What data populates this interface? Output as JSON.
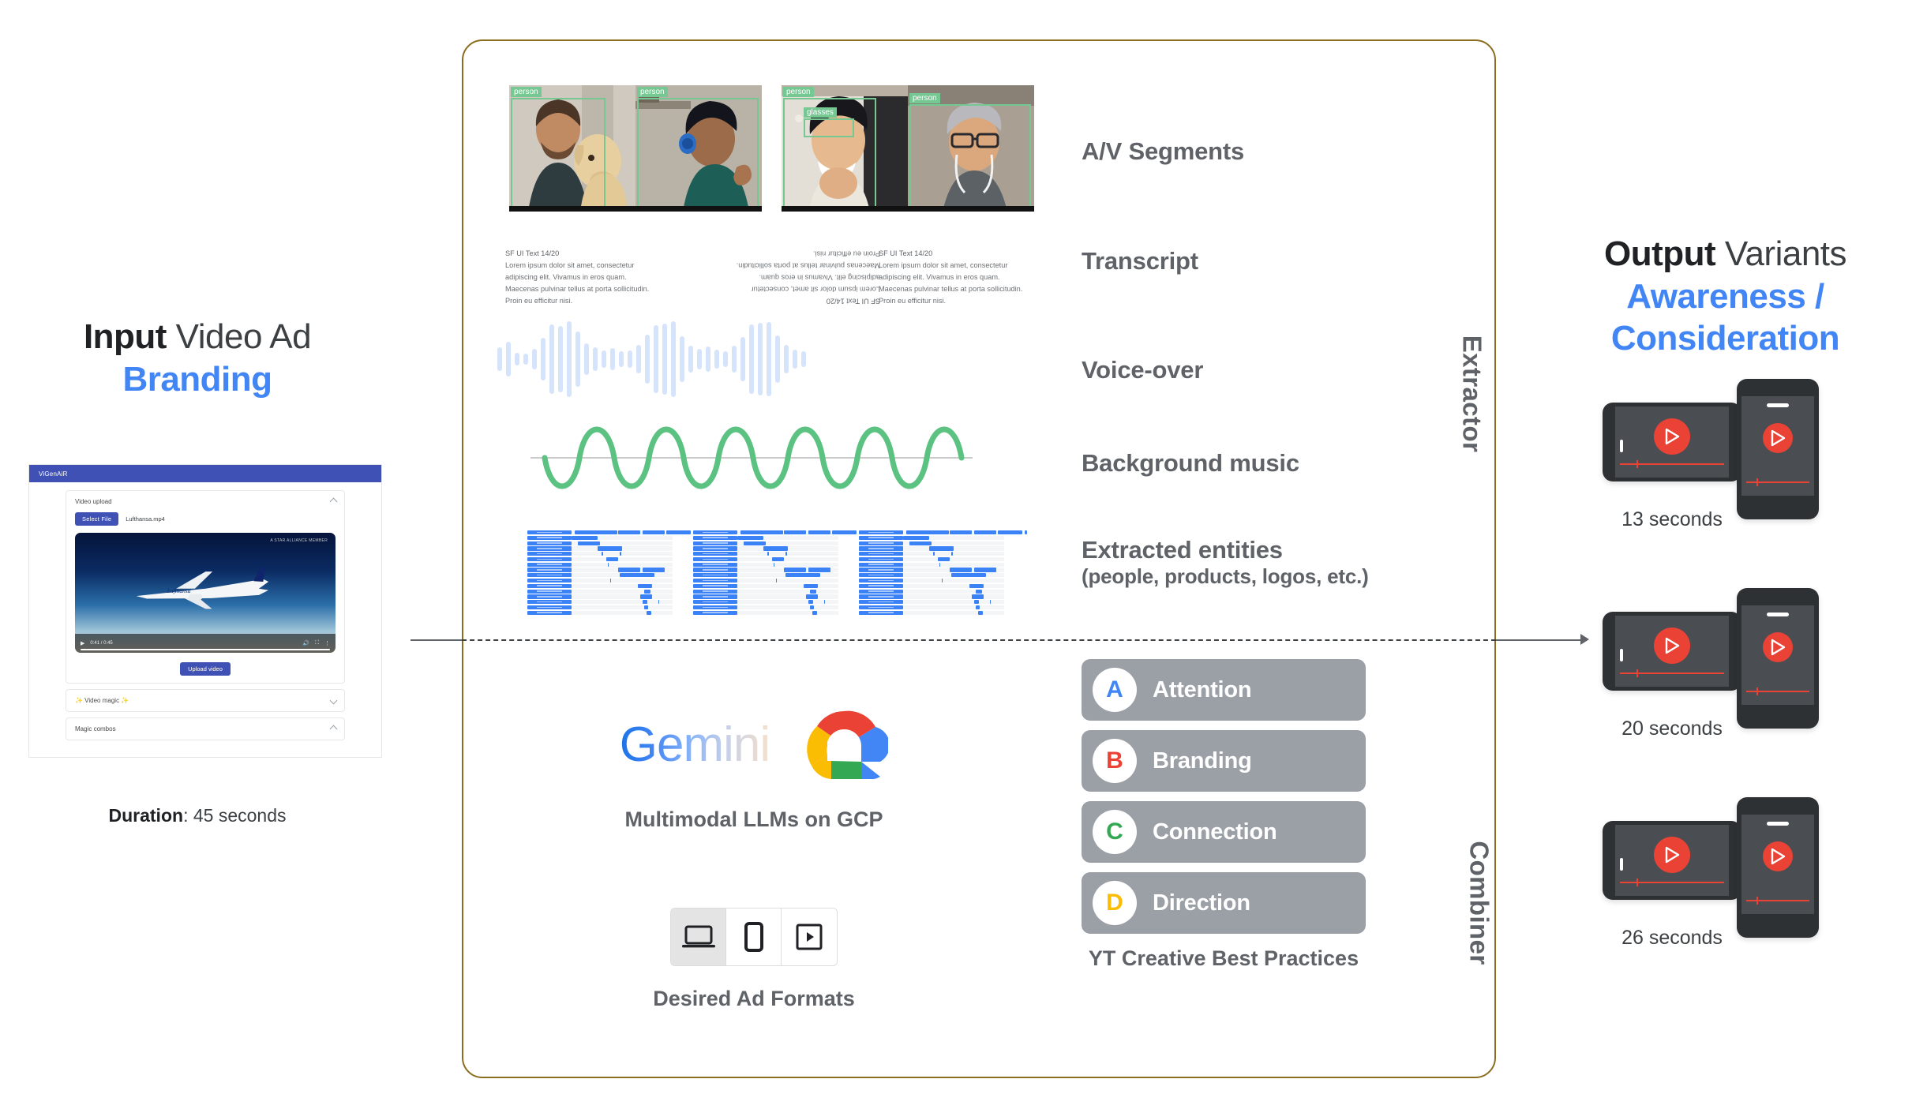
{
  "input": {
    "title_bold": "Input",
    "title_rest": " Video Ad",
    "title_accent": "Branding",
    "duration_label": "Duration",
    "duration_value": ": 45 seconds",
    "app": {
      "app_name": "ViGenAiR",
      "upload_card_title": "Video upload",
      "select_file_button": "Select File",
      "file_name": "Lufthansa.mp4",
      "star_alliance": "A STAR ALLIANCE MEMBER",
      "time_current": "0:41 / 0:45",
      "upload_button": "Upload video",
      "video_magic_title": "✨ Video magic ✨",
      "magic_combos_title": "Magic combos",
      "brand_text": "Lufthansa"
    }
  },
  "panel": {
    "section_extractor": "Extractor",
    "section_combiner": "Combiner",
    "border_color": "#8a6d1f",
    "rows": [
      {
        "label": "A/V Segments",
        "sub": ""
      },
      {
        "label": "Transcript",
        "sub": ""
      },
      {
        "label": "Voice-over",
        "sub": ""
      },
      {
        "label": "Background music",
        "sub": ""
      },
      {
        "label": "Extracted entities",
        "sub": "(people, products, logos, etc.)"
      }
    ],
    "detections": [
      {
        "tag": "person"
      },
      {
        "tag": "person"
      },
      {
        "tag": "person"
      },
      {
        "tag": "glasses"
      },
      {
        "tag": "person"
      }
    ],
    "transcript": {
      "heading": "SF UI Text 14/20",
      "line1": "Lorem ipsum dolor sit amet, consectetur",
      "line2": "adipiscing elit. Vivamus in eros quam.",
      "line3": "Maecenas pulvinar tellus at porta sollicitudin.",
      "line4": "Proin eu efficitur nisi."
    },
    "colors": {
      "waveform": "#d6e4fb",
      "music_wave": "#5cc281",
      "entity_bar": "#3b82f6",
      "detection_box": "#76c893"
    }
  },
  "combiner": {
    "gemini_wordmark": "Gemini",
    "llm_caption": "Multimodal LLMs on GCP",
    "formats_caption": "Desired Ad Formats",
    "formats": [
      {
        "icon": "laptop-icon",
        "selected": true
      },
      {
        "icon": "phone-icon",
        "selected": false
      },
      {
        "icon": "video-player-icon",
        "selected": false
      }
    ],
    "yt_caption": "YT Creative Best Practices",
    "best_practices": [
      {
        "letter": "A",
        "label": "Attention",
        "color": "#4285f4"
      },
      {
        "letter": "B",
        "label": "Branding",
        "color": "#ea4335"
      },
      {
        "letter": "C",
        "label": "Connection",
        "color": "#34a853"
      },
      {
        "letter": "D",
        "label": "Direction",
        "color": "#fbbc04"
      }
    ]
  },
  "output": {
    "title_bold": "Output",
    "title_rest": " Variants",
    "title_accent": "Awareness / Consideration",
    "variants": [
      {
        "duration": "13 seconds"
      },
      {
        "duration": "20 seconds"
      },
      {
        "duration": "26 seconds"
      }
    ]
  }
}
